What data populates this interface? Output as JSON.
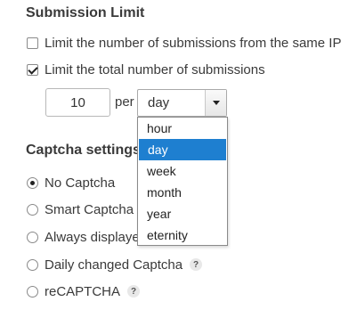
{
  "submission_limit": {
    "title": "Submission Limit",
    "limit_same_ip": {
      "label": "Limit the number of submissions from the same IP",
      "checked": false
    },
    "limit_total": {
      "label": "Limit the total number of submissions",
      "checked": true
    },
    "count_value": "10",
    "per_label": "per",
    "period_select": {
      "selected": "day",
      "options": [
        "hour",
        "day",
        "week",
        "month",
        "year",
        "eternity"
      ]
    }
  },
  "captcha": {
    "title": "Captcha settings",
    "options": [
      {
        "label": "No Captcha",
        "checked": true,
        "help": ""
      },
      {
        "label": "Smart Captcha",
        "checked": false,
        "help": ""
      },
      {
        "label": "Always displayed",
        "checked": false,
        "help": ""
      },
      {
        "label": "Daily changed Captcha",
        "checked": false,
        "help": "?"
      },
      {
        "label": "reCAPTCHA",
        "checked": false,
        "help": "?"
      }
    ]
  },
  "colors": {
    "accent": "#1e7fd0"
  }
}
